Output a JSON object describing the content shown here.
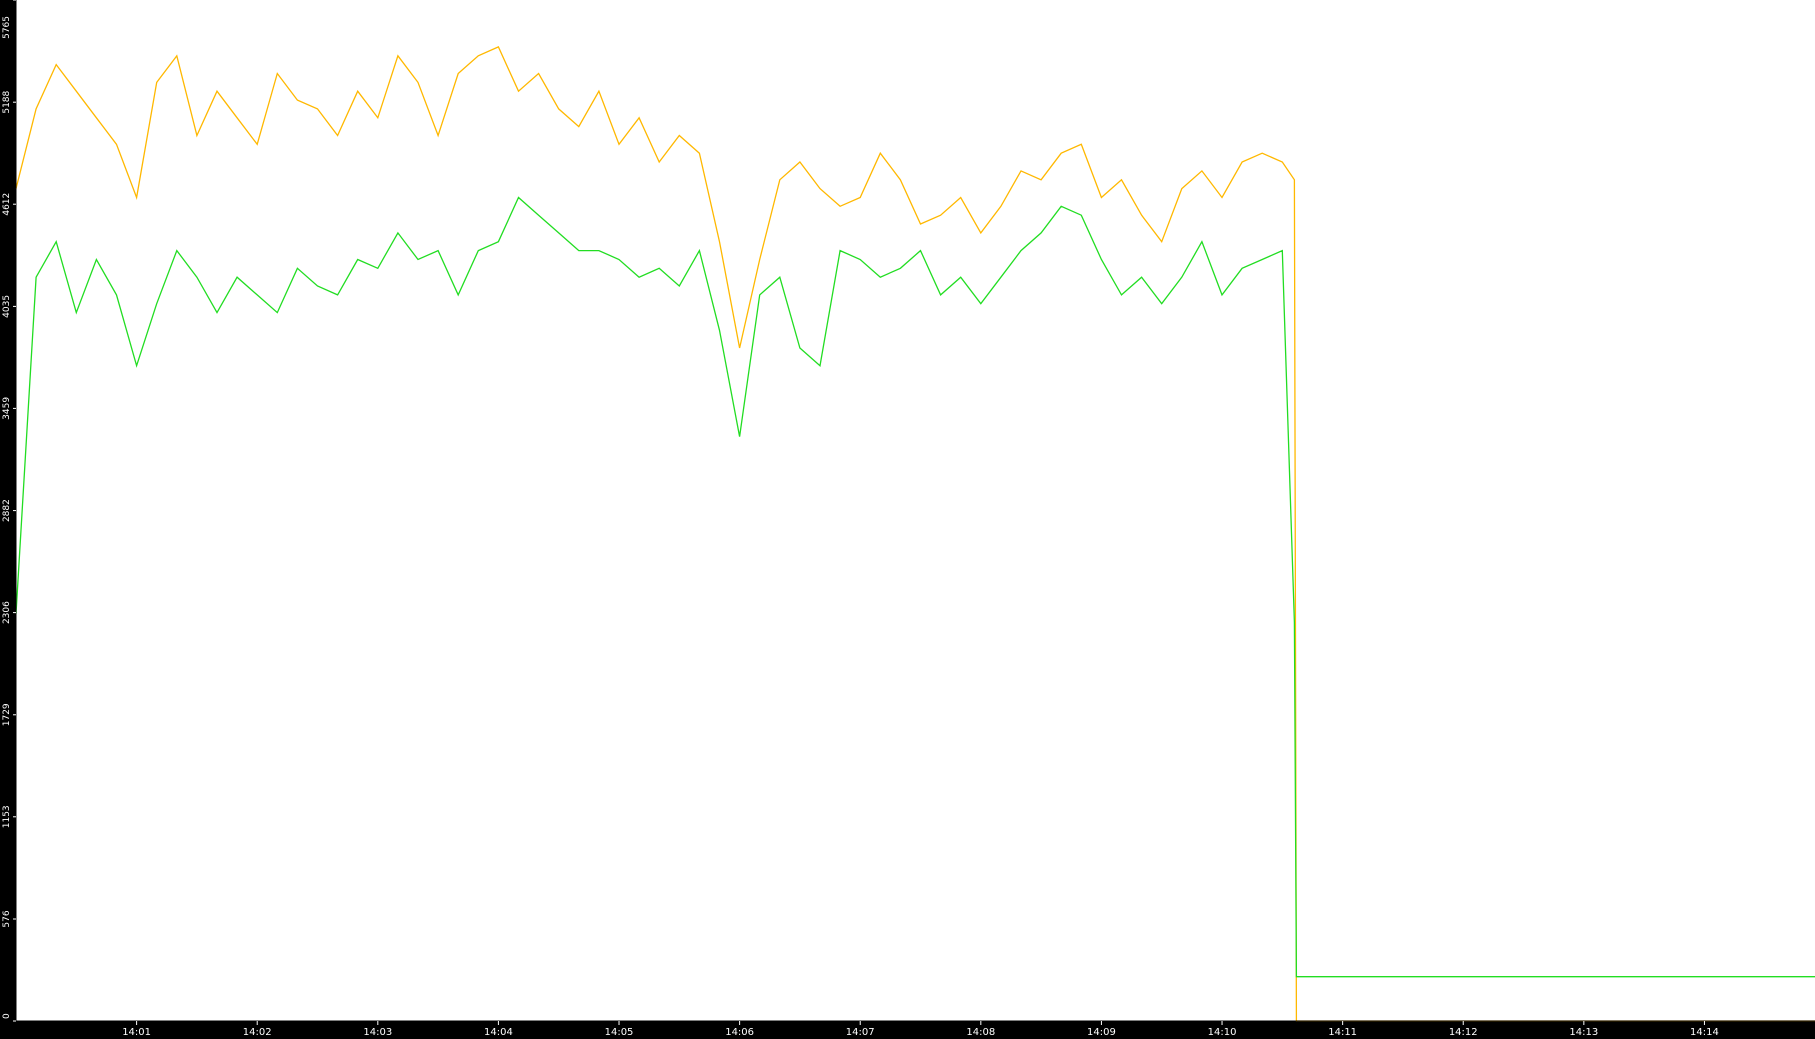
{
  "chart_data": {
    "type": "line",
    "title": "",
    "xlabel": "",
    "ylabel": "",
    "ylim": [
      0,
      5765
    ],
    "xlim": [
      "14:00:00",
      "14:14:55"
    ],
    "y_ticks": [
      "0",
      "576",
      "1153",
      "1729",
      "2306",
      "2882",
      "3459",
      "4035",
      "4612",
      "5188",
      "5765"
    ],
    "x_ticks": [
      "14:01",
      "14:02",
      "14:03",
      "14:04",
      "14:05",
      "14:06",
      "14:07",
      "14:08",
      "14:09",
      "14:10",
      "14:11",
      "14:12",
      "14:13",
      "14:14"
    ],
    "grid": false,
    "legend": "none",
    "colors": {
      "background": "#000000",
      "plot_background": "#ffffff",
      "axis": "#000000",
      "tick_text": "#ffffff"
    },
    "series": [
      {
        "color": "#ffb800",
        "x": [
          "14:00:00",
          "14:00:10",
          "14:00:20",
          "14:00:30",
          "14:00:40",
          "14:00:50",
          "14:01:00",
          "14:01:10",
          "14:01:20",
          "14:01:30",
          "14:01:40",
          "14:01:50",
          "14:02:00",
          "14:02:10",
          "14:02:20",
          "14:02:30",
          "14:02:40",
          "14:02:50",
          "14:03:00",
          "14:03:10",
          "14:03:20",
          "14:03:30",
          "14:03:40",
          "14:03:50",
          "14:04:00",
          "14:04:10",
          "14:04:20",
          "14:04:30",
          "14:04:40",
          "14:04:50",
          "14:05:00",
          "14:05:10",
          "14:05:20",
          "14:05:30",
          "14:05:40",
          "14:05:50",
          "14:06:00",
          "14:06:10",
          "14:06:20",
          "14:06:30",
          "14:06:40",
          "14:06:50",
          "14:07:00",
          "14:07:10",
          "14:07:20",
          "14:07:30",
          "14:07:40",
          "14:07:50",
          "14:08:00",
          "14:08:10",
          "14:08:20",
          "14:08:30",
          "14:08:40",
          "14:08:50",
          "14:09:00",
          "14:09:10",
          "14:09:20",
          "14:09:30",
          "14:09:40",
          "14:09:50",
          "14:10:00",
          "14:10:10",
          "14:10:20",
          "14:10:30",
          "14:10:36",
          "14:10:37",
          "14:11:00",
          "14:12:00",
          "14:13:00",
          "14:14:00",
          "14:14:55"
        ],
        "values": [
          4700,
          5150,
          5400,
          5250,
          5100,
          4950,
          4650,
          5300,
          5450,
          5000,
          5250,
          5100,
          4950,
          5350,
          5200,
          5150,
          5000,
          5250,
          5100,
          5450,
          5300,
          5000,
          5350,
          5450,
          5500,
          5250,
          5350,
          5150,
          5050,
          5250,
          4950,
          5100,
          4850,
          5000,
          4900,
          4400,
          3800,
          4300,
          4750,
          4850,
          4700,
          4600,
          4650,
          4900,
          4750,
          4500,
          4550,
          4650,
          4450,
          4600,
          4800,
          4750,
          4900,
          4950,
          4650,
          4750,
          4550,
          4400,
          4700,
          4800,
          4650,
          4850,
          4900,
          4850,
          4750,
          0,
          0,
          0,
          0,
          0,
          0
        ]
      },
      {
        "color": "#22dd22",
        "x": [
          "14:00:00",
          "14:00:10",
          "14:00:20",
          "14:00:30",
          "14:00:40",
          "14:00:50",
          "14:01:00",
          "14:01:10",
          "14:01:20",
          "14:01:30",
          "14:01:40",
          "14:01:50",
          "14:02:00",
          "14:02:10",
          "14:02:20",
          "14:02:30",
          "14:02:40",
          "14:02:50",
          "14:03:00",
          "14:03:10",
          "14:03:20",
          "14:03:30",
          "14:03:40",
          "14:03:50",
          "14:04:00",
          "14:04:10",
          "14:04:20",
          "14:04:30",
          "14:04:40",
          "14:04:50",
          "14:05:00",
          "14:05:10",
          "14:05:20",
          "14:05:30",
          "14:05:40",
          "14:05:50",
          "14:06:00",
          "14:06:10",
          "14:06:20",
          "14:06:30",
          "14:06:40",
          "14:06:50",
          "14:07:00",
          "14:07:10",
          "14:07:20",
          "14:07:30",
          "14:07:40",
          "14:07:50",
          "14:08:00",
          "14:08:10",
          "14:08:20",
          "14:08:30",
          "14:08:40",
          "14:08:50",
          "14:09:00",
          "14:09:10",
          "14:09:20",
          "14:09:30",
          "14:09:40",
          "14:09:50",
          "14:10:00",
          "14:10:10",
          "14:10:20",
          "14:10:30",
          "14:10:36",
          "14:10:37",
          "14:11:00",
          "14:12:00",
          "14:13:00",
          "14:14:00",
          "14:14:55"
        ],
        "values": [
          2300,
          4200,
          4400,
          4000,
          4300,
          4100,
          3700,
          4050,
          4350,
          4200,
          4000,
          4200,
          4100,
          4000,
          4250,
          4150,
          4100,
          4300,
          4250,
          4450,
          4300,
          4350,
          4100,
          4350,
          4400,
          4650,
          4550,
          4450,
          4350,
          4350,
          4300,
          4200,
          4250,
          4150,
          4350,
          3900,
          3300,
          4100,
          4200,
          3800,
          3700,
          4350,
          4300,
          4200,
          4250,
          4350,
          4100,
          4200,
          4050,
          4200,
          4350,
          4450,
          4600,
          4550,
          4300,
          4100,
          4200,
          4050,
          4200,
          4400,
          4100,
          4250,
          4300,
          4350,
          2250,
          250,
          250,
          250,
          250,
          250,
          250
        ]
      }
    ]
  }
}
